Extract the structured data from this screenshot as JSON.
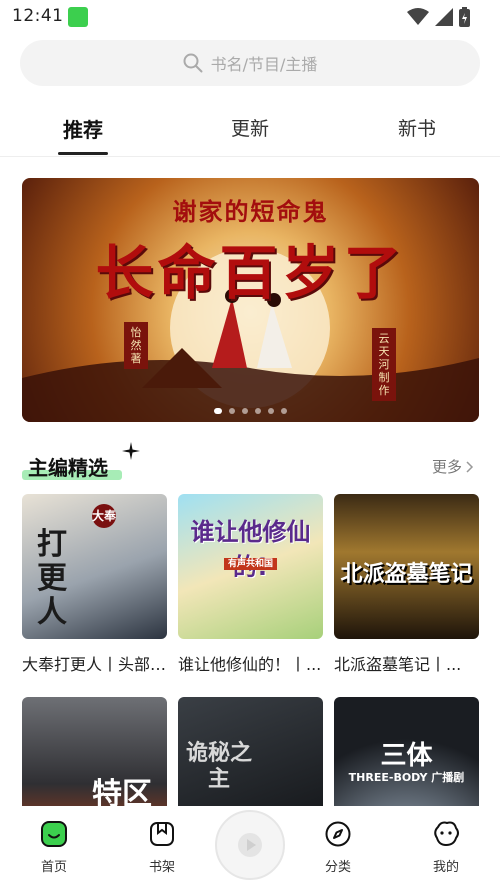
{
  "status_bar": {
    "time": "12:41"
  },
  "search": {
    "placeholder": "书名/节目/主播"
  },
  "tabs": [
    {
      "label": "推荐",
      "active": true
    },
    {
      "label": "更新",
      "active": false
    },
    {
      "label": "新书",
      "active": false
    }
  ],
  "banner": {
    "subtitle": "谢家的短命鬼",
    "title": "长命百岁了",
    "author": "怡然著",
    "producer": "云天河制作",
    "dots": 6,
    "active_dot": 0
  },
  "section": {
    "title": "主编精选",
    "more_label": "更多"
  },
  "books": [
    {
      "title": "大奉打更人丨头部大神...",
      "cover_text": "打更人",
      "cover_tag": "大奉"
    },
    {
      "title": "谁让他修仙的！丨...",
      "cover_text": "谁让他修仙的!",
      "cover_tag": "有声共和国"
    },
    {
      "title": "北派盗墓笔记丨...",
      "cover_text": "北派盗墓笔记",
      "cover_tag": ""
    },
    {
      "title": "",
      "cover_text": "特区",
      "cover_tag": ""
    },
    {
      "title": "",
      "cover_text": "诡秘之主",
      "cover_tag": ""
    },
    {
      "title": "",
      "cover_text": "三体",
      "cover_tag": "THREE-BODY 广播剧"
    }
  ],
  "bottom_nav": [
    {
      "label": "首页",
      "icon": "home-icon",
      "active": true
    },
    {
      "label": "书架",
      "icon": "bookshelf-icon",
      "active": false
    },
    {
      "label": "分类",
      "icon": "category-icon",
      "active": false
    },
    {
      "label": "我的",
      "icon": "profile-icon",
      "active": false
    }
  ],
  "colors": {
    "accent": "#3ccf4e",
    "highlight": "#a7ecb6",
    "banner_red": "#b10d0d"
  }
}
